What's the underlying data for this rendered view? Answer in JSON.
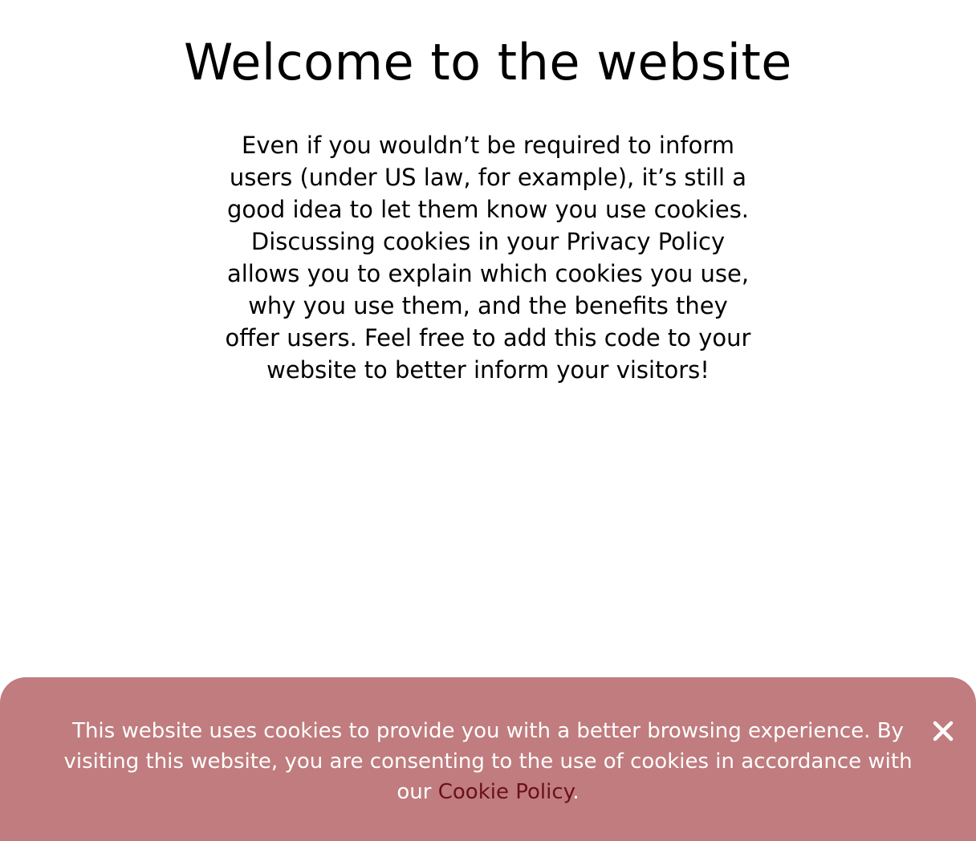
{
  "main": {
    "title": "Welcome to the website",
    "body": "Even if you wouldn’t be required to inform users (under US law, for example), it’s still a good idea to let them know you use cookies. Discussing cookies in your Privacy Policy allows you to explain which cookies you use, why you use them, and the benefits they offer users. Feel free to add this code to your website to better inform your visitors!"
  },
  "cookie_banner": {
    "message_before_link": "This website uses cookies to provide you with a better browsing experience. By visiting this website, you are consenting to the use of cookies in accordance with our ",
    "link_text": "Cookie Policy",
    "message_after_link": ".",
    "close_icon": "close-icon"
  },
  "colors": {
    "banner_background": "#c07c7e",
    "banner_text": "#ffffff",
    "link": "#6b0f1f"
  }
}
